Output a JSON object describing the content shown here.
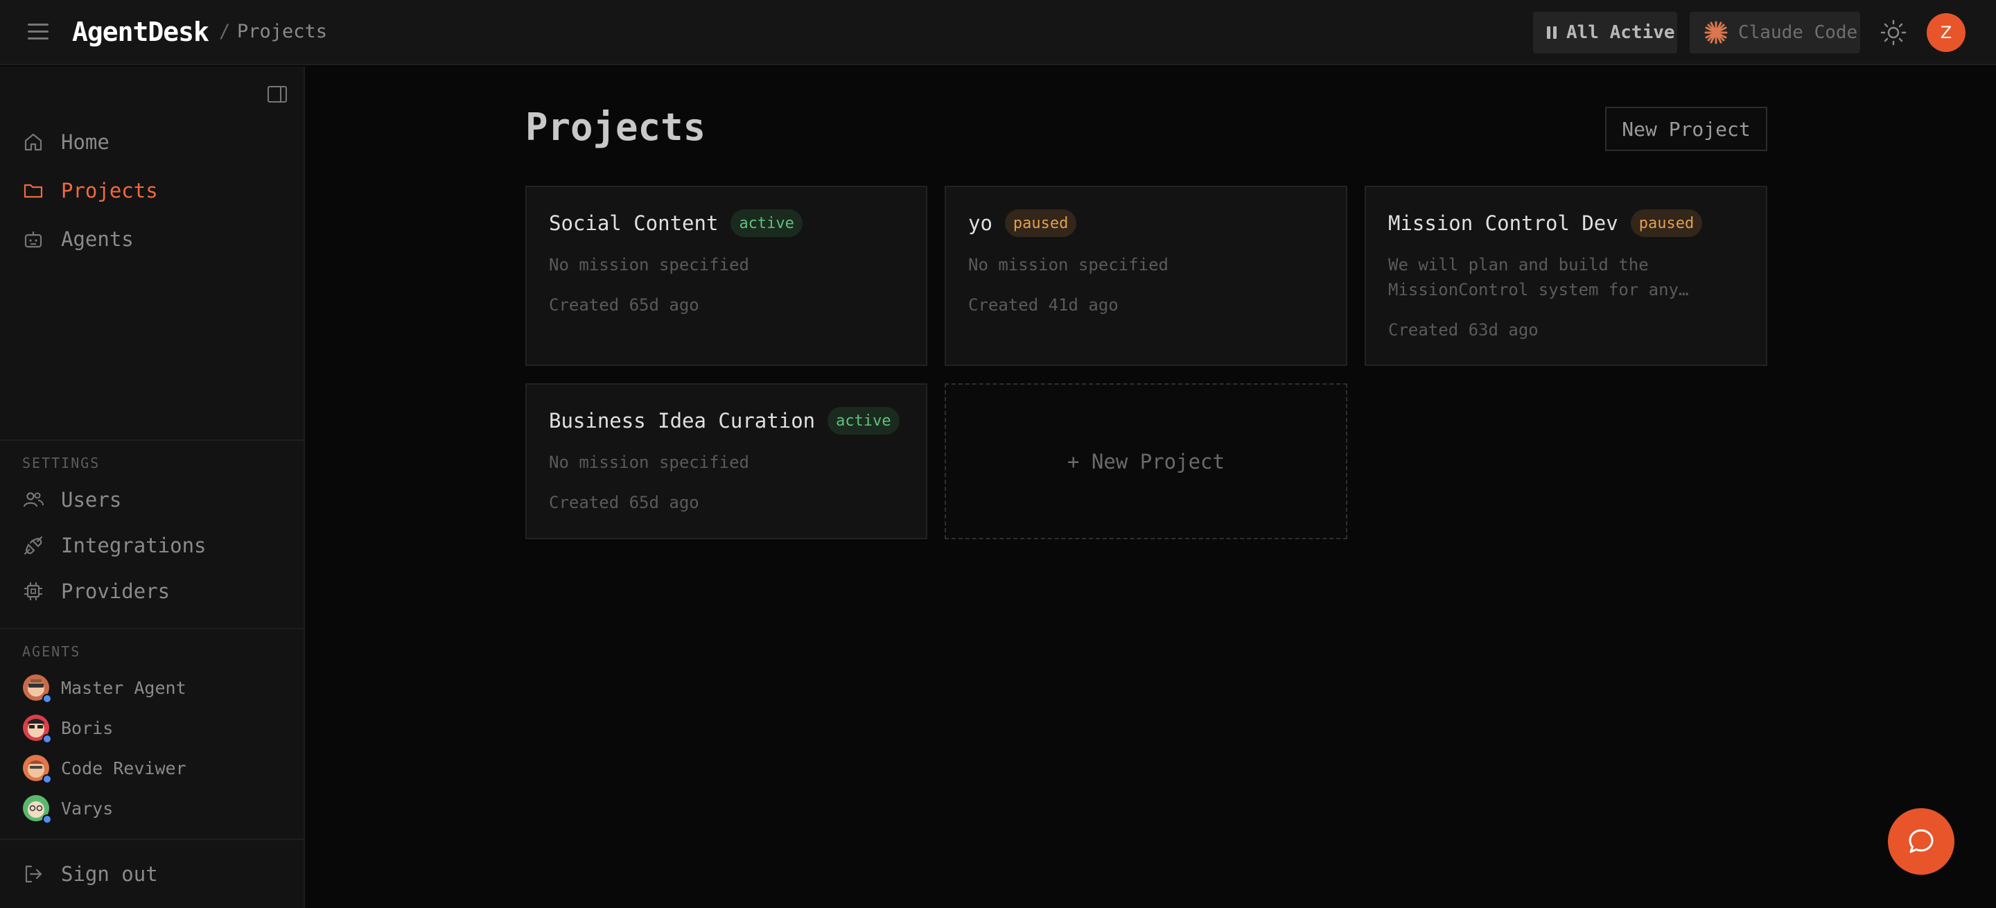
{
  "header": {
    "logo": "AgentDesk",
    "breadcrumb_sep": "/",
    "breadcrumb": "Projects",
    "all_active_label": "All Active",
    "claude_code_label": "Claude Code",
    "user_initial": "Z"
  },
  "sidebar": {
    "nav": [
      {
        "label": "Home",
        "icon": "home-icon"
      },
      {
        "label": "Projects",
        "icon": "folder-icon",
        "active": true
      },
      {
        "label": "Agents",
        "icon": "robot-icon"
      }
    ],
    "settings_label": "SETTINGS",
    "settings": [
      {
        "label": "Users",
        "icon": "users-icon"
      },
      {
        "label": "Integrations",
        "icon": "plug-icon"
      },
      {
        "label": "Providers",
        "icon": "chip-icon"
      }
    ],
    "agents_label": "AGENTS",
    "agents": [
      {
        "name": "Master Agent"
      },
      {
        "name": "Boris"
      },
      {
        "name": "Code Reviwer"
      },
      {
        "name": "Varys"
      }
    ],
    "sign_out": "Sign out"
  },
  "main": {
    "title": "Projects",
    "new_project_button": "New Project",
    "new_project_card": "+ New Project",
    "projects": [
      {
        "title": "Social Content",
        "status": "active",
        "mission": "No mission specified",
        "created": "Created 65d ago"
      },
      {
        "title": "yo",
        "status": "paused",
        "mission": "No mission specified",
        "created": "Created 41d ago"
      },
      {
        "title": "Mission Control Dev",
        "status": "paused",
        "mission": "We will plan and build the MissionControl system for any…",
        "created": "Created 63d ago"
      },
      {
        "title": "Business Idea Curation",
        "status": "active",
        "mission": "No mission specified",
        "created": "Created 65d ago"
      }
    ]
  },
  "colors": {
    "accent": "#e8552a",
    "active_badge": "#5ec27a",
    "paused_badge": "#e3a04a"
  }
}
